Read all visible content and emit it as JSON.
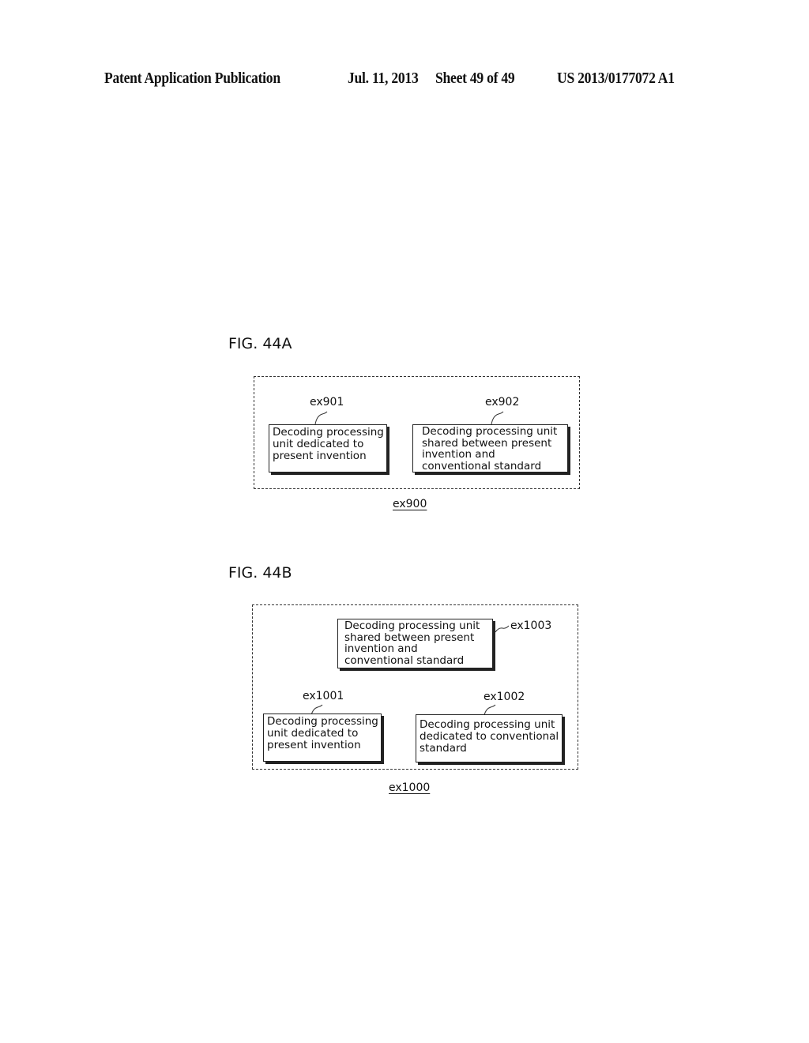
{
  "header": {
    "left": "Patent Application Publication",
    "date": "Jul. 11, 2013",
    "sheet": "Sheet 49 of 49",
    "number": "US 2013/0177072 A1"
  },
  "fig44a": {
    "label": "FIG. 44A",
    "container_ref": "ex900",
    "units": [
      {
        "ref": "ex901",
        "lines": [
          "Decoding processing",
          "unit dedicated to",
          "present invention"
        ]
      },
      {
        "ref": "ex902",
        "lines": [
          "Decoding processing unit",
          "shared between present",
          "invention and",
          "conventional standard"
        ]
      }
    ]
  },
  "fig44b": {
    "label": "FIG. 44B",
    "container_ref": "ex1000",
    "units": [
      {
        "ref": "ex1003",
        "lines": [
          "Decoding processing unit",
          "shared between present",
          "invention and",
          "conventional standard"
        ]
      },
      {
        "ref": "ex1001",
        "lines": [
          "Decoding processing",
          "unit dedicated to",
          "present invention"
        ]
      },
      {
        "ref": "ex1002",
        "lines": [
          "Decoding processing unit",
          "dedicated to conventional",
          "standard"
        ]
      }
    ]
  }
}
